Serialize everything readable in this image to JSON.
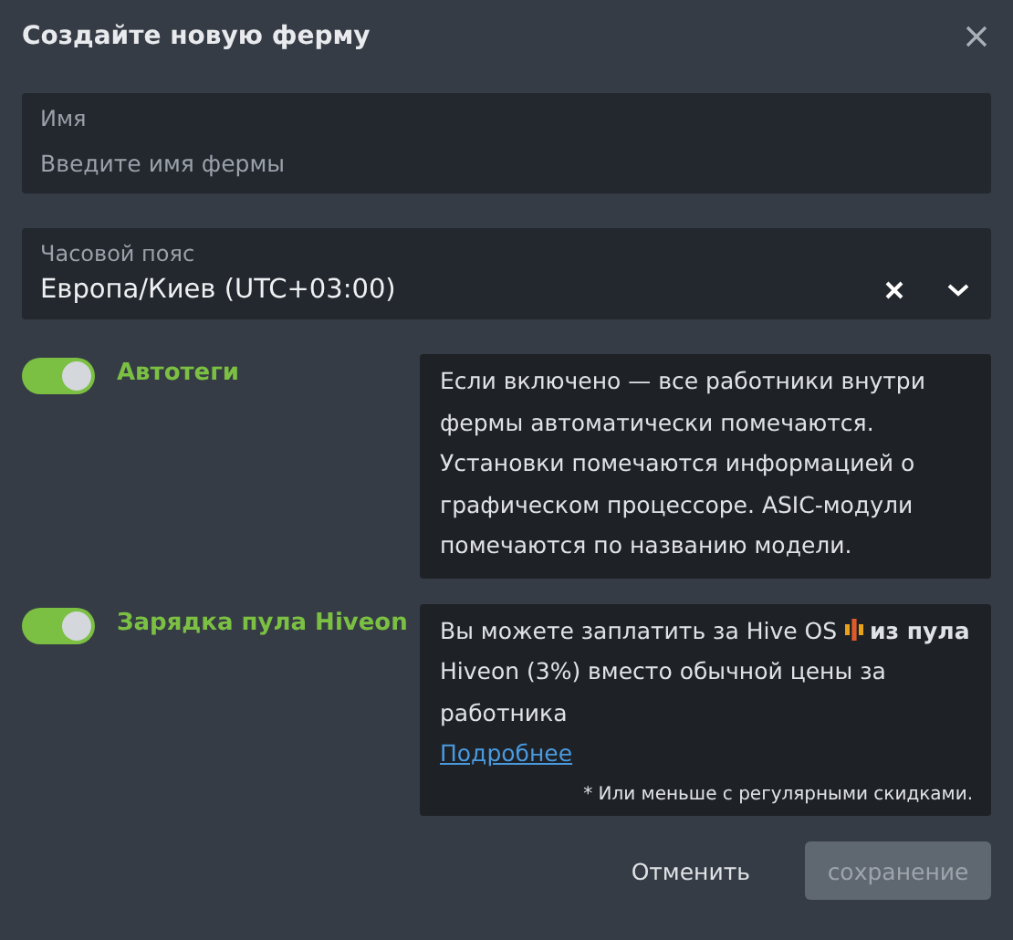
{
  "dialog": {
    "title": "Создайте новую ферму"
  },
  "name_field": {
    "label": "Имя",
    "placeholder": "Введите имя фермы"
  },
  "timezone_field": {
    "label": "Часовой пояс",
    "value": "Европа/Киев (UTC+03:00)"
  },
  "options": [
    {
      "label": "Автотеги",
      "on": true,
      "info": {
        "text": "Если включено — все работники внутри фермы автоматически помечаются. Установки помечаются информацией о графическом процессоре. ASIC-модули помечаются по названию модели."
      }
    },
    {
      "label": "Зарядка пула Hiveon",
      "on": true,
      "info": {
        "text_before_icon": "Вы можете заплатить за Hive OS",
        "text_after_icon": "**из пула** Hiveon (3%) вместо обычной цены за работника",
        "link": "Подробнее",
        "footnote": "* Или меньше с регулярными скидками."
      }
    }
  ],
  "buttons": {
    "cancel": "Отменить",
    "save": {
      "label": "сохранение",
      "disabled": true
    }
  }
}
